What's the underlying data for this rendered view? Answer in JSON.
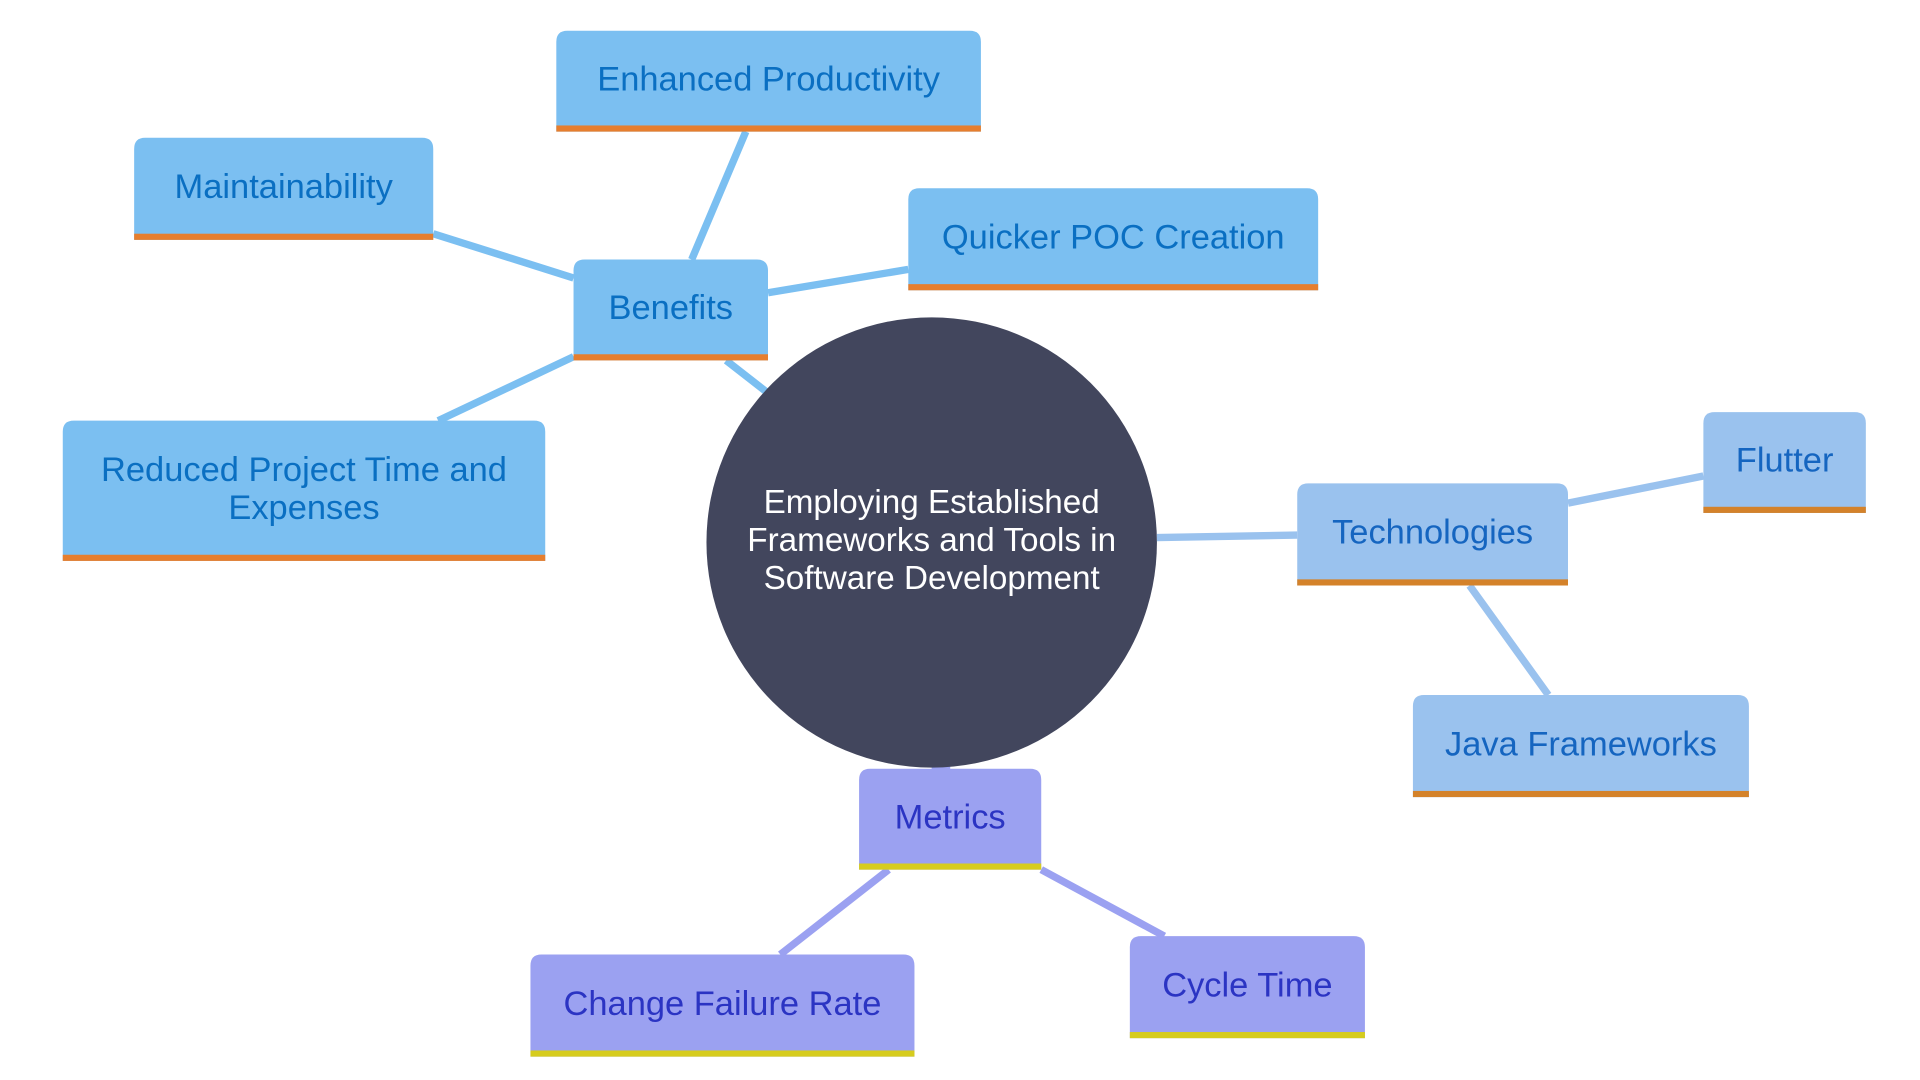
{
  "title": "Employing Established Frameworks and Tools in Software Development",
  "colors": {
    "background": "#ffffff",
    "center_fill": "#42465d",
    "center_text": "#ffffff",
    "benefits_fill": "#7bbff1",
    "benefits_text": "#0a6fc2",
    "benefits_edge": "#7bbff1",
    "benefits_underline": "#e67e2e",
    "technologies_fill": "#9ac2ee",
    "technologies_text": "#1565c0",
    "technologies_edge": "#9ac2ee",
    "technologies_underline": "#d4822a",
    "metrics_fill": "#9ba1f1",
    "metrics_text": "#2b34c3",
    "metrics_edge": "#9ba1f1",
    "metrics_underline": "#d6cc1e"
  },
  "center": {
    "lines": [
      "Employing Established",
      "Frameworks and Tools in",
      "Software Development"
    ]
  },
  "branches": [
    {
      "id": "benefits",
      "label": "Benefits",
      "children": [
        {
          "id": "enhanced-productivity",
          "lines": [
            "Enhanced Productivity"
          ]
        },
        {
          "id": "maintainability",
          "lines": [
            "Maintainability"
          ]
        },
        {
          "id": "quicker-poc-creation",
          "lines": [
            "Quicker POC Creation"
          ]
        },
        {
          "id": "reduced-project-time",
          "lines": [
            "Reduced Project Time and",
            "Expenses"
          ]
        }
      ]
    },
    {
      "id": "technologies",
      "label": "Technologies",
      "children": [
        {
          "id": "flutter",
          "lines": [
            "Flutter"
          ]
        },
        {
          "id": "java-frameworks",
          "lines": [
            "Java Frameworks"
          ]
        }
      ]
    },
    {
      "id": "metrics",
      "label": "Metrics",
      "children": [
        {
          "id": "change-failure-rate",
          "lines": [
            "Change Failure Rate"
          ]
        },
        {
          "id": "cycle-time",
          "lines": [
            "Cycle Time"
          ]
        }
      ]
    }
  ]
}
